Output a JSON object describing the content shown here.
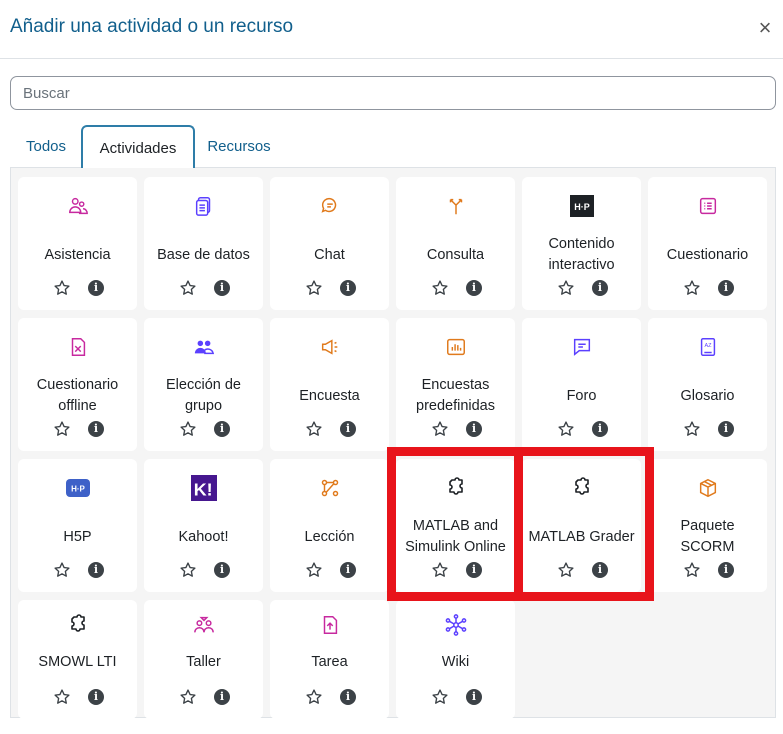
{
  "modal": {
    "title": "Añadir una actividad o un recurso",
    "close_label": "×"
  },
  "search": {
    "placeholder": "Buscar",
    "value": ""
  },
  "tabs": [
    {
      "label": "Todos"
    },
    {
      "label": "Actividades",
      "active": true
    },
    {
      "label": "Recursos"
    }
  ],
  "items": [
    {
      "label": "Asistencia",
      "icon": "attendance-icon",
      "color": "#c7299f"
    },
    {
      "label": "Base de datos",
      "icon": "database-icon",
      "color": "#5b40ff"
    },
    {
      "label": "Chat",
      "icon": "chat-icon",
      "color": "#e07a1c"
    },
    {
      "label": "Consulta",
      "icon": "choice-icon",
      "color": "#e07a1c"
    },
    {
      "label": "Contenido interactivo",
      "icon": "h5p-logo-icon",
      "color": "#1d2125"
    },
    {
      "label": "Cuestionario",
      "icon": "quiz-icon",
      "color": "#c7299f"
    },
    {
      "label": "Cuestionario offline",
      "icon": "offline-quiz-icon",
      "color": "#c7299f"
    },
    {
      "label": "Elección de grupo",
      "icon": "group-choice-icon",
      "color": "#5b40ff"
    },
    {
      "label": "Encuesta",
      "icon": "feedback-icon",
      "color": "#e07a1c"
    },
    {
      "label": "Encuestas predefinidas",
      "icon": "survey-icon",
      "color": "#e07a1c"
    },
    {
      "label": "Foro",
      "icon": "forum-icon",
      "color": "#5b40ff"
    },
    {
      "label": "Glosario",
      "icon": "glossary-icon",
      "color": "#5b40ff"
    },
    {
      "label": "H5P",
      "icon": "h5p-icon",
      "color": "#3e61c8"
    },
    {
      "label": "Kahoot!",
      "icon": "kahoot-icon",
      "color": "#46178f"
    },
    {
      "label": "Lección",
      "icon": "lesson-icon",
      "color": "#e07a1c"
    },
    {
      "label": "MATLAB and Simulink Online",
      "icon": "puzzle-icon",
      "color": "#1d2125"
    },
    {
      "label": "MATLAB Grader",
      "icon": "puzzle-icon",
      "color": "#1d2125"
    },
    {
      "label": "Paquete SCORM",
      "icon": "scorm-icon",
      "color": "#e07a1c"
    },
    {
      "label": "SMOWL LTI",
      "icon": "puzzle-icon",
      "color": "#1d2125"
    },
    {
      "label": "Taller",
      "icon": "workshop-icon",
      "color": "#c7299f"
    },
    {
      "label": "Tarea",
      "icon": "assignment-icon",
      "color": "#c7299f"
    },
    {
      "label": "Wiki",
      "icon": "wiki-icon",
      "color": "#5b40ff"
    }
  ],
  "colors": {
    "highlight": "#e8141b",
    "link": "#115f8c"
  }
}
